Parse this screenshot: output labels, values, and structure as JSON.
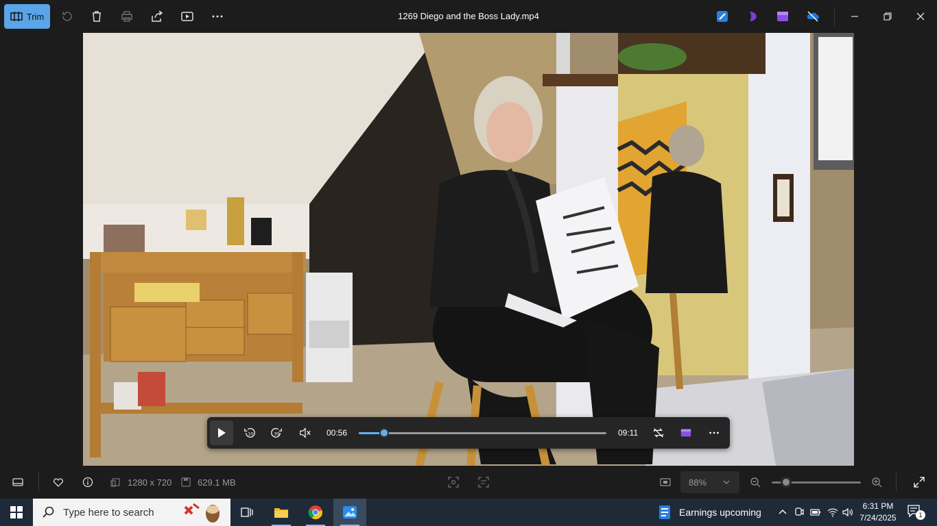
{
  "toolbar": {
    "trim_label": "Trim",
    "file_title": "1269 Diego and the Boss Lady.mp4"
  },
  "player": {
    "current_time": "00:56",
    "total_time": "09:11",
    "progress": 0.102
  },
  "status": {
    "resolution": "1280 x 720",
    "file_size": "629.1 MB",
    "zoom_level": "88%",
    "zoom_slider": 0.16
  },
  "taskbar": {
    "search_placeholder": "Type here to search",
    "weather_text": "Earnings upcoming",
    "time": "6:31 PM",
    "date": "7/24/2025",
    "notification_count": "1"
  },
  "colors": {
    "accent": "#5aa4e8",
    "seek": "#60b0f0",
    "taskbar": "#1f2a38"
  }
}
